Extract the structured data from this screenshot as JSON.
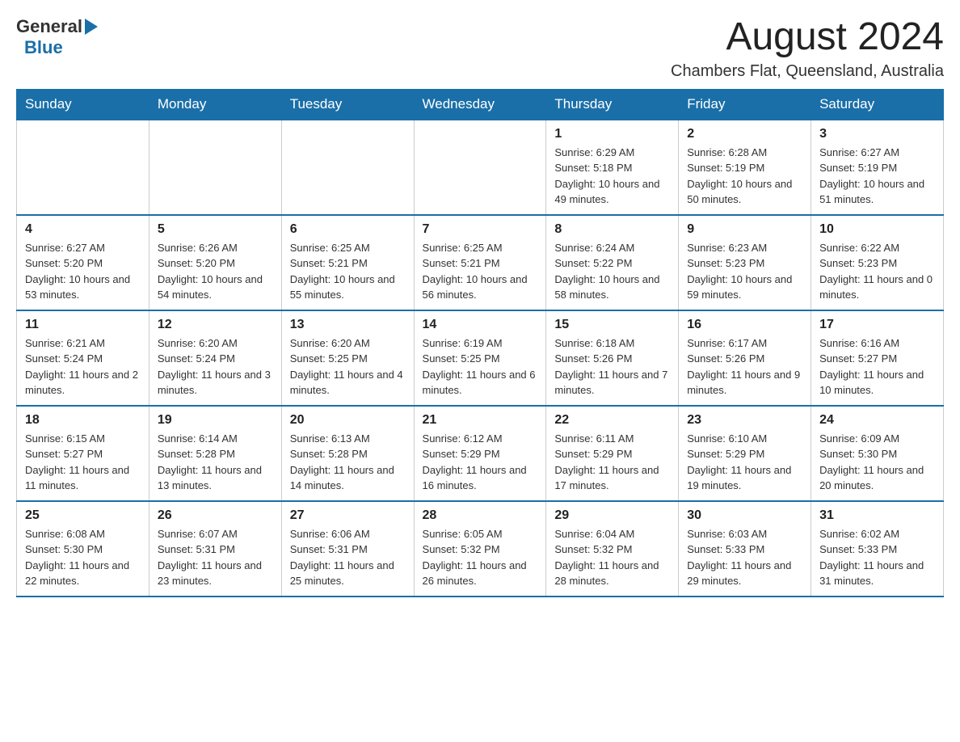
{
  "header": {
    "logo_general": "General",
    "logo_blue": "Blue",
    "month_title": "August 2024",
    "location": "Chambers Flat, Queensland, Australia"
  },
  "days_of_week": [
    "Sunday",
    "Monday",
    "Tuesday",
    "Wednesday",
    "Thursday",
    "Friday",
    "Saturday"
  ],
  "weeks": [
    [
      {
        "day": "",
        "info": ""
      },
      {
        "day": "",
        "info": ""
      },
      {
        "day": "",
        "info": ""
      },
      {
        "day": "",
        "info": ""
      },
      {
        "day": "1",
        "info": "Sunrise: 6:29 AM\nSunset: 5:18 PM\nDaylight: 10 hours and 49 minutes."
      },
      {
        "day": "2",
        "info": "Sunrise: 6:28 AM\nSunset: 5:19 PM\nDaylight: 10 hours and 50 minutes."
      },
      {
        "day": "3",
        "info": "Sunrise: 6:27 AM\nSunset: 5:19 PM\nDaylight: 10 hours and 51 minutes."
      }
    ],
    [
      {
        "day": "4",
        "info": "Sunrise: 6:27 AM\nSunset: 5:20 PM\nDaylight: 10 hours and 53 minutes."
      },
      {
        "day": "5",
        "info": "Sunrise: 6:26 AM\nSunset: 5:20 PM\nDaylight: 10 hours and 54 minutes."
      },
      {
        "day": "6",
        "info": "Sunrise: 6:25 AM\nSunset: 5:21 PM\nDaylight: 10 hours and 55 minutes."
      },
      {
        "day": "7",
        "info": "Sunrise: 6:25 AM\nSunset: 5:21 PM\nDaylight: 10 hours and 56 minutes."
      },
      {
        "day": "8",
        "info": "Sunrise: 6:24 AM\nSunset: 5:22 PM\nDaylight: 10 hours and 58 minutes."
      },
      {
        "day": "9",
        "info": "Sunrise: 6:23 AM\nSunset: 5:23 PM\nDaylight: 10 hours and 59 minutes."
      },
      {
        "day": "10",
        "info": "Sunrise: 6:22 AM\nSunset: 5:23 PM\nDaylight: 11 hours and 0 minutes."
      }
    ],
    [
      {
        "day": "11",
        "info": "Sunrise: 6:21 AM\nSunset: 5:24 PM\nDaylight: 11 hours and 2 minutes."
      },
      {
        "day": "12",
        "info": "Sunrise: 6:20 AM\nSunset: 5:24 PM\nDaylight: 11 hours and 3 minutes."
      },
      {
        "day": "13",
        "info": "Sunrise: 6:20 AM\nSunset: 5:25 PM\nDaylight: 11 hours and 4 minutes."
      },
      {
        "day": "14",
        "info": "Sunrise: 6:19 AM\nSunset: 5:25 PM\nDaylight: 11 hours and 6 minutes."
      },
      {
        "day": "15",
        "info": "Sunrise: 6:18 AM\nSunset: 5:26 PM\nDaylight: 11 hours and 7 minutes."
      },
      {
        "day": "16",
        "info": "Sunrise: 6:17 AM\nSunset: 5:26 PM\nDaylight: 11 hours and 9 minutes."
      },
      {
        "day": "17",
        "info": "Sunrise: 6:16 AM\nSunset: 5:27 PM\nDaylight: 11 hours and 10 minutes."
      }
    ],
    [
      {
        "day": "18",
        "info": "Sunrise: 6:15 AM\nSunset: 5:27 PM\nDaylight: 11 hours and 11 minutes."
      },
      {
        "day": "19",
        "info": "Sunrise: 6:14 AM\nSunset: 5:28 PM\nDaylight: 11 hours and 13 minutes."
      },
      {
        "day": "20",
        "info": "Sunrise: 6:13 AM\nSunset: 5:28 PM\nDaylight: 11 hours and 14 minutes."
      },
      {
        "day": "21",
        "info": "Sunrise: 6:12 AM\nSunset: 5:29 PM\nDaylight: 11 hours and 16 minutes."
      },
      {
        "day": "22",
        "info": "Sunrise: 6:11 AM\nSunset: 5:29 PM\nDaylight: 11 hours and 17 minutes."
      },
      {
        "day": "23",
        "info": "Sunrise: 6:10 AM\nSunset: 5:29 PM\nDaylight: 11 hours and 19 minutes."
      },
      {
        "day": "24",
        "info": "Sunrise: 6:09 AM\nSunset: 5:30 PM\nDaylight: 11 hours and 20 minutes."
      }
    ],
    [
      {
        "day": "25",
        "info": "Sunrise: 6:08 AM\nSunset: 5:30 PM\nDaylight: 11 hours and 22 minutes."
      },
      {
        "day": "26",
        "info": "Sunrise: 6:07 AM\nSunset: 5:31 PM\nDaylight: 11 hours and 23 minutes."
      },
      {
        "day": "27",
        "info": "Sunrise: 6:06 AM\nSunset: 5:31 PM\nDaylight: 11 hours and 25 minutes."
      },
      {
        "day": "28",
        "info": "Sunrise: 6:05 AM\nSunset: 5:32 PM\nDaylight: 11 hours and 26 minutes."
      },
      {
        "day": "29",
        "info": "Sunrise: 6:04 AM\nSunset: 5:32 PM\nDaylight: 11 hours and 28 minutes."
      },
      {
        "day": "30",
        "info": "Sunrise: 6:03 AM\nSunset: 5:33 PM\nDaylight: 11 hours and 29 minutes."
      },
      {
        "day": "31",
        "info": "Sunrise: 6:02 AM\nSunset: 5:33 PM\nDaylight: 11 hours and 31 minutes."
      }
    ]
  ],
  "colors": {
    "header_bg": "#1a6fa8",
    "header_text": "#ffffff",
    "border": "#1a6fa8",
    "cell_border": "#cccccc",
    "day_number": "#222222",
    "day_info": "#333333"
  }
}
